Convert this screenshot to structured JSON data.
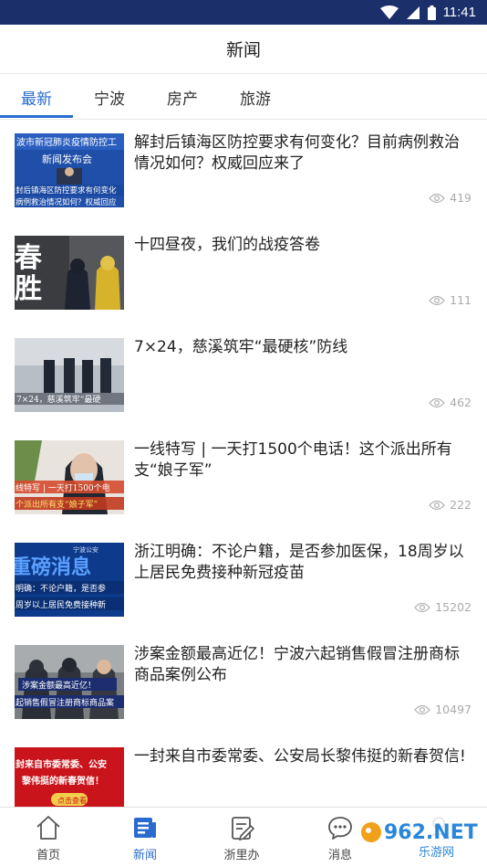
{
  "status_bar": {
    "time": "11:41"
  },
  "header": {
    "title": "新闻"
  },
  "tabs": [
    {
      "label": "最新",
      "active": true
    },
    {
      "label": "宁波",
      "active": false
    },
    {
      "label": "房产",
      "active": false
    },
    {
      "label": "旅游",
      "active": false
    }
  ],
  "news": [
    {
      "title": "解封后镇海区防控要求有何变化？目前病例救治情况如何？权威回应来了",
      "views": "419",
      "thumb_text": [
        "波市新冠肺炎疫情防控工",
        "新闻发布会",
        "封后镇海区防控要求有何变化",
        "病例救治情况如何？权威回应"
      ]
    },
    {
      "title": "十四昼夜，我们的战疫答卷",
      "views": "111",
      "thumb_text": [
        "春",
        "胜"
      ]
    },
    {
      "title": "7×24，慈溪筑牢“最硬核”防线",
      "views": "462",
      "thumb_text": [
        "7×24，慈溪筑牢“最硬"
      ]
    },
    {
      "title": "一线特写 | 一天打1500个电话！这个派出所有支“娘子军”",
      "views": "222",
      "thumb_text": [
        "线特写 | 一天打1500个电",
        "个派出所有支“娘子军”"
      ]
    },
    {
      "title": "浙江明确：不论户籍，是否参加医保，18周岁以上居民免费接种新冠疫苗",
      "views": "15202",
      "thumb_text": [
        "宁波公安",
        "重磅消息",
        "明确：不论户籍，是否参",
        "周岁以上居民免费接种新"
      ]
    },
    {
      "title": "涉案金额最高近亿！宁波六起销售假冒注册商标商品案例公布",
      "views": "10497",
      "thumb_text": [
        "涉案金额最高近亿！",
        "起销售假冒注册商标商品案"
      ]
    },
    {
      "title": "一封来自市委常委、公安局长黎伟挺的新春贺信!",
      "views": "",
      "thumb_text": [
        "封来自市委常委、公安",
        "黎伟挺的新春贺信！",
        "点击查看"
      ]
    }
  ],
  "bottom_nav": [
    {
      "label": "首页",
      "icon": "home-icon",
      "active": false
    },
    {
      "label": "新闻",
      "icon": "news-icon",
      "active": true
    },
    {
      "label": "浙里办",
      "icon": "service-icon",
      "active": false
    },
    {
      "label": "消息",
      "icon": "message-icon",
      "active": false
    },
    {
      "label": "",
      "icon": "profile-icon",
      "active": false
    }
  ],
  "watermark": {
    "text": "962.NET",
    "subtext": "乐游网"
  },
  "colors": {
    "status_bar": "#1b2f6b",
    "accent": "#2a6bd0",
    "view_gray": "#aaaaaa"
  }
}
